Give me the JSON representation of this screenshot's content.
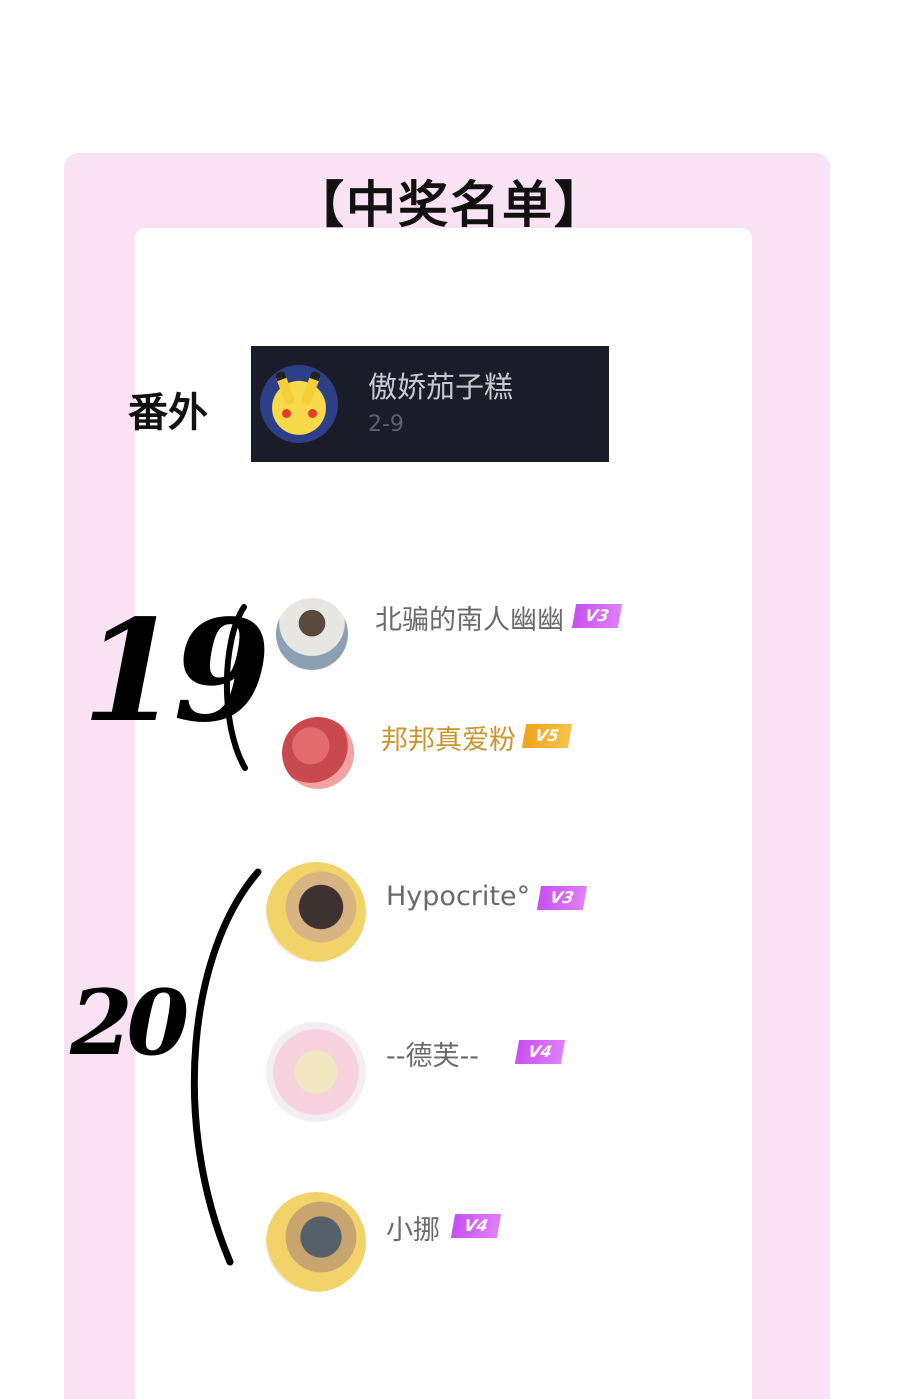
{
  "title": "【中奖名单】",
  "special": {
    "label": "番外",
    "name": "傲娇茄子糕",
    "sub": "2-9"
  },
  "group_19": {
    "number": "19",
    "users": [
      {
        "name": "北骗的南人幽幽",
        "level": "V3",
        "badge_color": "#c84ff0"
      },
      {
        "name": "邦邦真爱粉",
        "level": "V5",
        "badge_color": "#f0a21c"
      }
    ]
  },
  "group_20": {
    "number": "20",
    "users": [
      {
        "name": "Hypocrite°",
        "level": "V3",
        "badge_color": "#c84ff0"
      },
      {
        "name": "--德芙--",
        "level": "V4",
        "badge_color": "#c84ff0"
      },
      {
        "name": "小挪",
        "level": "V4",
        "badge_color": "#c84ff0"
      }
    ]
  },
  "colors": {
    "frame": "#f9e2f4",
    "card": "#ffffff",
    "special_box": "#1b1c2a"
  }
}
